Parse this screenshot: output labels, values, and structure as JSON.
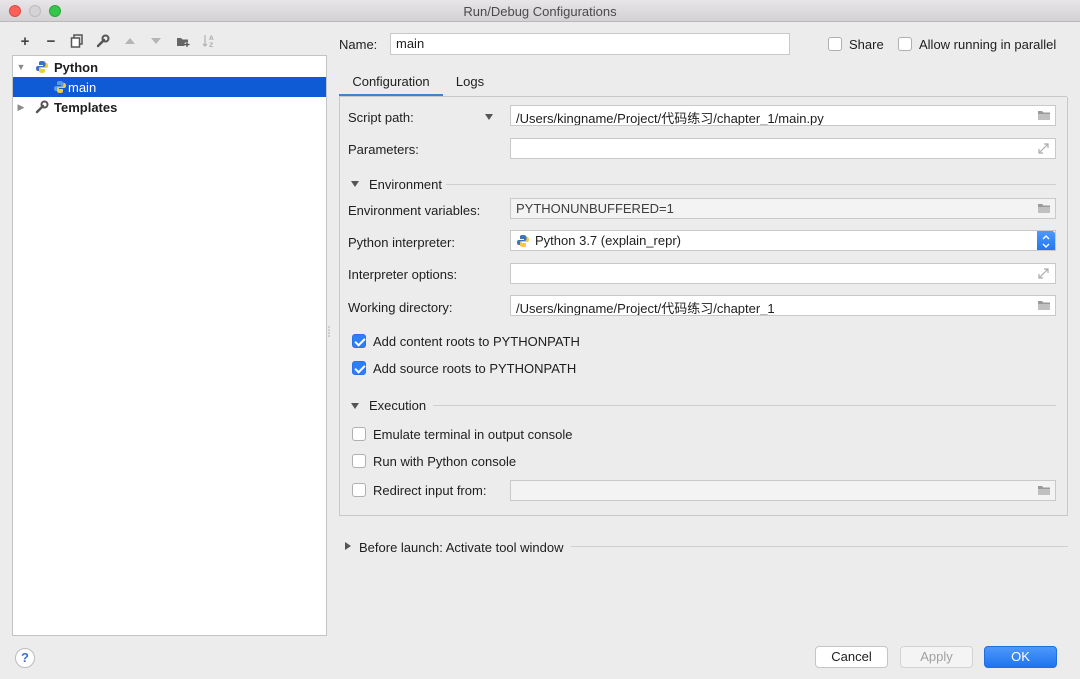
{
  "window": {
    "title": "Run/Debug Configurations"
  },
  "toolbar": {
    "add": "+",
    "remove": "−"
  },
  "tree": {
    "items": [
      {
        "label": "Python"
      },
      {
        "label": "main"
      },
      {
        "label": "Templates"
      }
    ]
  },
  "form": {
    "name_label": "Name:",
    "name_value": "main",
    "share_label": "Share",
    "parallel_label": "Allow running in parallel",
    "tabs": [
      {
        "label": "Configuration"
      },
      {
        "label": "Logs"
      }
    ],
    "script_path_label": "Script path:",
    "script_path_value": "/Users/kingname/Project/代码练习/chapter_1/main.py",
    "parameters_label": "Parameters:",
    "parameters_value": "",
    "environment_section": "Environment",
    "env_vars_label": "Environment variables:",
    "env_vars_value": "PYTHONUNBUFFERED=1",
    "interpreter_label": "Python interpreter:",
    "interpreter_value": "Python 3.7 (explain_repr)",
    "interp_options_label": "Interpreter options:",
    "interp_options_value": "",
    "working_dir_label": "Working directory:",
    "working_dir_value": "/Users/kingname/Project/代码练习/chapter_1",
    "content_roots_label": "Add content roots to PYTHONPATH",
    "source_roots_label": "Add source roots to PYTHONPATH",
    "execution_section": "Execution",
    "emulate_terminal_label": "Emulate terminal in output console",
    "python_console_label": "Run with Python console",
    "redirect_input_label": "Redirect input from:",
    "redirect_input_value": "",
    "before_launch_label": "Before launch: Activate tool window"
  },
  "buttons": {
    "help": "?",
    "cancel": "Cancel",
    "apply": "Apply",
    "ok": "OK"
  },
  "colors": {
    "selection": "#0f5ad5",
    "accent": "#2d7ef8"
  }
}
